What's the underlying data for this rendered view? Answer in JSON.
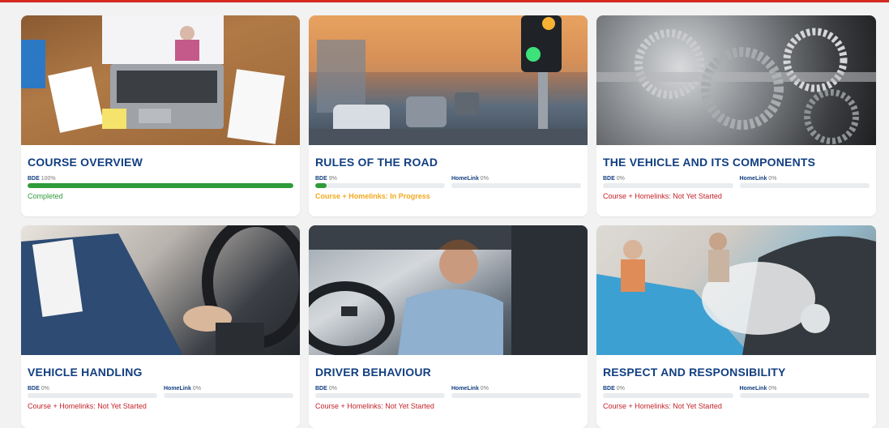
{
  "colors": {
    "top_accent": "#d42a20",
    "title": "#123f82",
    "bar_fill_done": "#2f9b3a",
    "bar_fill_prog": "#2f9b3a",
    "status_done": "#2f9b3a",
    "status_progress": "#f2a81d",
    "status_none": "#c4232a"
  },
  "cards": [
    {
      "title": "COURSE OVERVIEW",
      "bars": [
        {
          "label": "BDE",
          "pct": "100%",
          "value": 1.0
        }
      ],
      "status": "Completed",
      "status_type": "done"
    },
    {
      "title": "RULES OF THE ROAD",
      "bars": [
        {
          "label": "BDE",
          "pct": "9%",
          "value": 0.09
        },
        {
          "label": "HomeLink",
          "pct": "0%",
          "value": 0
        }
      ],
      "status": "Course + Homelinks: In Progress",
      "status_type": "prog"
    },
    {
      "title": "THE VEHICLE AND ITS COMPONENTS",
      "bars": [
        {
          "label": "BDE",
          "pct": "0%",
          "value": 0
        },
        {
          "label": "HomeLink",
          "pct": "0%",
          "value": 0
        }
      ],
      "status": "Course + Homelinks: Not Yet Started",
      "status_type": "none"
    },
    {
      "title": "VEHICLE HANDLING",
      "bars": [
        {
          "label": "BDE",
          "pct": "0%",
          "value": 0
        },
        {
          "label": "HomeLink",
          "pct": "0%",
          "value": 0
        }
      ],
      "status": "Course + Homelinks: Not Yet Started",
      "status_type": "none"
    },
    {
      "title": "DRIVER BEHAVIOUR",
      "bars": [
        {
          "label": "BDE",
          "pct": "0%",
          "value": 0
        },
        {
          "label": "HomeLink",
          "pct": "0%",
          "value": 0
        }
      ],
      "status": "Course + Homelinks: Not Yet Started",
      "status_type": "none"
    },
    {
      "title": "RESPECT AND RESPONSIBILITY",
      "bars": [
        {
          "label": "BDE",
          "pct": "0%",
          "value": 0
        },
        {
          "label": "HomeLink",
          "pct": "0%",
          "value": 0
        }
      ],
      "status": "Course + Homelinks: Not Yet Started",
      "status_type": "none"
    }
  ]
}
